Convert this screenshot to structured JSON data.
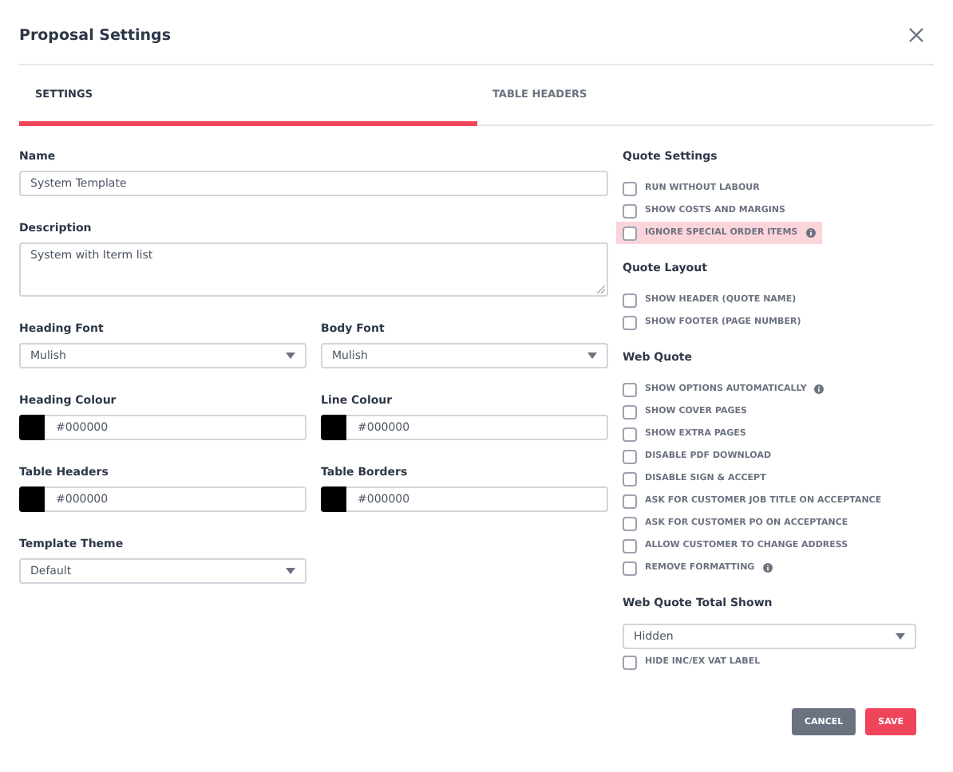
{
  "dialog": {
    "title": "Proposal Settings"
  },
  "tabs": [
    {
      "label": "SETTINGS",
      "selected": true
    },
    {
      "label": "TABLE HEADERS",
      "selected": false
    }
  ],
  "left_fields": [
    [
      {
        "kind": "text",
        "label": "Name",
        "value": "System Template"
      }
    ],
    [
      {
        "kind": "textarea",
        "label": "Description",
        "value": "System with Iterm list"
      }
    ],
    [
      {
        "kind": "select",
        "label": "Heading Font",
        "value": "Mulish"
      },
      {
        "kind": "select",
        "label": "Body Font",
        "value": "Mulish"
      }
    ],
    [
      {
        "kind": "color",
        "label": "Heading Colour",
        "value": "#000000",
        "color": "#000000"
      },
      {
        "kind": "color",
        "label": "Line Colour",
        "value": "#000000",
        "color": "#000000"
      }
    ],
    [
      {
        "kind": "color",
        "label": "Table Headers",
        "value": "#000000",
        "color": "#000000"
      },
      {
        "kind": "color",
        "label": "Table Borders",
        "value": "#000000",
        "color": "#000000"
      }
    ],
    [
      {
        "kind": "select",
        "label": "Template Theme",
        "value": "Default"
      }
    ]
  ],
  "sections": [
    {
      "title": "Quote Settings",
      "options": [
        {
          "label": "RUN WITHOUT LABOUR",
          "checked": false,
          "info": false,
          "highlighted": false
        },
        {
          "label": "SHOW COSTS AND MARGINS",
          "checked": false,
          "info": false,
          "highlighted": false
        },
        {
          "label": "IGNORE SPECIAL ORDER ITEMS",
          "checked": false,
          "info": true,
          "highlighted": true
        }
      ]
    },
    {
      "title": "Quote Layout",
      "options": [
        {
          "label": "SHOW HEADER (QUOTE NAME)",
          "checked": false,
          "info": false,
          "highlighted": false
        },
        {
          "label": "SHOW FOOTER (PAGE NUMBER)",
          "checked": false,
          "info": false,
          "highlighted": false
        }
      ]
    },
    {
      "title": "Web Quote",
      "options": [
        {
          "label": "SHOW OPTIONS AUTOMATICALLY",
          "checked": false,
          "info": true,
          "highlighted": false
        },
        {
          "label": "SHOW COVER PAGES",
          "checked": false,
          "info": false,
          "highlighted": false
        },
        {
          "label": "SHOW EXTRA PAGES",
          "checked": false,
          "info": false,
          "highlighted": false
        },
        {
          "label": "DISABLE PDF DOWNLOAD",
          "checked": false,
          "info": false,
          "highlighted": false
        },
        {
          "label": "DISABLE SIGN & ACCEPT",
          "checked": false,
          "info": false,
          "highlighted": false
        },
        {
          "label": "ASK FOR CUSTOMER JOB TITLE ON ACCEPTANCE",
          "checked": false,
          "info": false,
          "highlighted": false
        },
        {
          "label": "ASK FOR CUSTOMER PO ON ACCEPTANCE",
          "checked": false,
          "info": false,
          "highlighted": false
        },
        {
          "label": "ALLOW CUSTOMER TO CHANGE ADDRESS",
          "checked": false,
          "info": false,
          "highlighted": false
        },
        {
          "label": "REMOVE FORMATTING",
          "checked": false,
          "info": true,
          "highlighted": false
        }
      ]
    }
  ],
  "total_shown": {
    "label": "Web Quote Total Shown",
    "value": "Hidden",
    "option": {
      "label": "HIDE INC/EX VAT LABEL",
      "checked": false
    }
  },
  "buttons": [
    {
      "label": "CANCEL",
      "kind": "secondary"
    },
    {
      "label": "SAVE",
      "kind": "primary"
    }
  ]
}
